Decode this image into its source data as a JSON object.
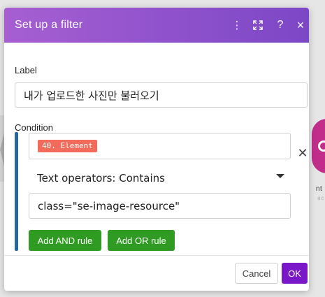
{
  "window": {
    "title": "Set up a filter"
  },
  "header": {
    "icons": {
      "menu": "kebab-icon",
      "expand": "expand-icon",
      "help": "help-icon",
      "close": "close-icon"
    },
    "help_glyph": "?",
    "close_glyph": "×",
    "menu_glyph": "⋮",
    "expand_glyph": "⤢"
  },
  "form": {
    "label_title": "Label",
    "label_value": "내가 업로드한 사진만 불러오기",
    "condition_title": "Condition",
    "condition": {
      "element_pill": "40. Element",
      "operator": "Text operators: Contains",
      "value": "class=\"se-image-resource\"",
      "remove_glyph": "✕"
    },
    "buttons": {
      "add_and": "Add AND rule",
      "add_or": "Add OR rule"
    }
  },
  "footer": {
    "cancel_label": "Cancel",
    "ok_label": "OK"
  },
  "background": {
    "right_text": "nt",
    "right_sub": "ac"
  },
  "colors": {
    "header_gradient_start": "#a65fd2",
    "header_gradient_end": "#7c47c6",
    "condition_bar": "#2467a7",
    "element_pill": "#f26b5b",
    "green_button": "#2f9b22",
    "ok_button": "#7a17c9",
    "bg_module": "#c02d8b"
  }
}
